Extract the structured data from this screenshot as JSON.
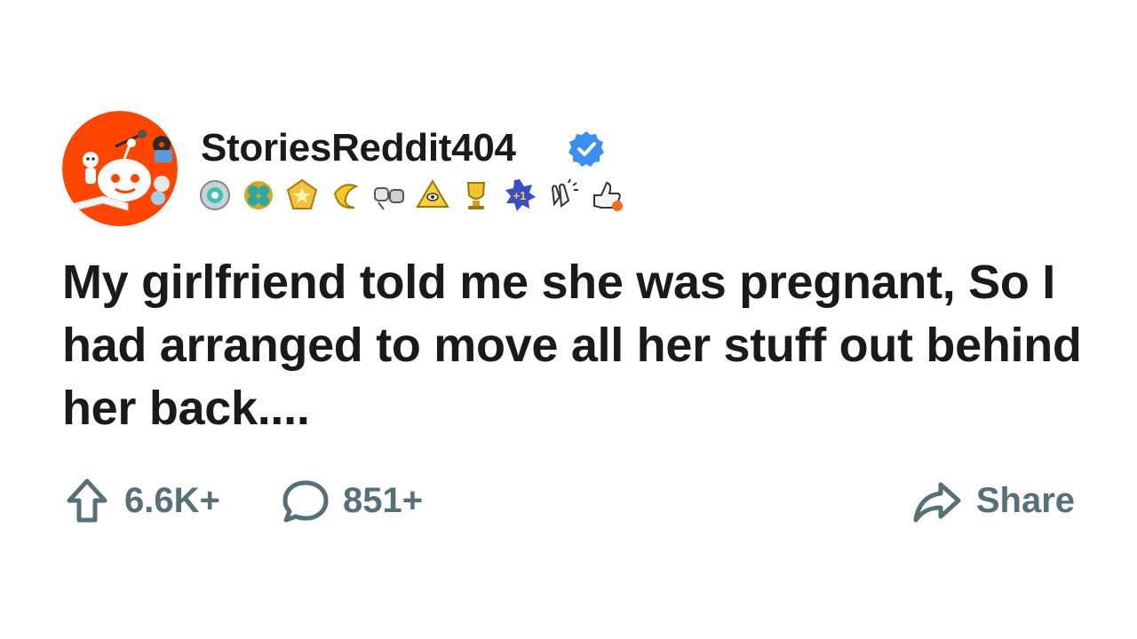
{
  "post": {
    "author": {
      "username": "StoriesReddit404",
      "verified": true,
      "avatar_icon": "reddit-snoo-avatar-icon"
    },
    "badges": [
      "silver-badge-icon",
      "clover-badge-icon",
      "gold-badge-icon",
      "banana-badge-icon",
      "fist-bump-badge-icon",
      "pyramid-badge-icon",
      "trophy-badge-icon",
      "plus-one-badge-icon",
      "clapping-hands-badge-icon",
      "thumbs-up-badge-icon"
    ],
    "title": "My girlfriend told me she was pregnant, So I had arranged to move all her stuff out behind her back....",
    "actions": {
      "upvotes": "6.6K+",
      "comments": "851+",
      "share_label": "Share"
    }
  },
  "colors": {
    "avatar_bg": "#ff4500",
    "verified_blue": "#3b8ff0",
    "action_gray": "#576f76",
    "text": "#1a1a1b"
  }
}
